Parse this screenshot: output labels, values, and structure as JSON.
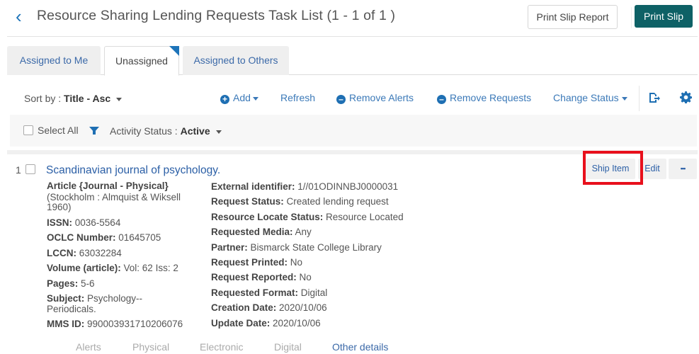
{
  "header": {
    "back_icon": "chevron-left",
    "title": "Resource Sharing Lending Requests Task List (1 - 1 of 1 )",
    "print_slip_report": "Print Slip Report",
    "print_slip": "Print Slip"
  },
  "tabs": [
    {
      "label": "Assigned to Me",
      "active": false
    },
    {
      "label": "Unassigned",
      "active": true
    },
    {
      "label": "Assigned to Others",
      "active": false
    }
  ],
  "toolbar": {
    "sort_label": "Sort by : ",
    "sort_value": "Title - Asc",
    "add": "Add",
    "refresh": "Refresh",
    "remove_alerts": "Remove Alerts",
    "remove_requests": "Remove Requests",
    "change_status": "Change Status",
    "export_icon": "export",
    "settings_icon": "gear"
  },
  "filterbar": {
    "select_all": "Select All",
    "filter_icon": "funnel",
    "activity_label": "Activity Status : ",
    "activity_value": "Active"
  },
  "record": {
    "index": "1",
    "title": "Scandinavian journal of psychology.",
    "type": "Article {Journal - Physical}",
    "publication": "(Stockholm : Almquist & Wiksell 1960)",
    "left_fields": [
      {
        "label": "ISSN:",
        "value": " 0036-5564"
      },
      {
        "label": "OCLC Number:",
        "value": " 01645705"
      },
      {
        "label": "LCCN:",
        "value": " 63032284"
      },
      {
        "label": "Volume (article):",
        "value": " Vol: 62 Iss: 2"
      },
      {
        "label": "Pages:",
        "value": " 5-6"
      },
      {
        "label": "Subject:",
        "value": " Psychology--Periodicals."
      },
      {
        "label": "MMS ID:",
        "value": " 990003931710206076"
      }
    ],
    "right_fields": [
      {
        "label": "External identifier:",
        "value": " 1//01ODINNBJ0000031"
      },
      {
        "label": "Request Status:",
        "value": " Created lending request"
      },
      {
        "label": "Resource Locate Status:",
        "value": " Resource Located"
      },
      {
        "label": "Requested Media:",
        "value": " Any"
      },
      {
        "label": "Partner:",
        "value": " Bismarck State College Library"
      },
      {
        "label": "Request Printed:",
        "value": " No"
      },
      {
        "label": "Request Reported:",
        "value": " No"
      },
      {
        "label": "Requested Format:",
        "value": " Digital"
      },
      {
        "label": "Creation Date:",
        "value": " 2020/10/06"
      },
      {
        "label": "Update Date:",
        "value": " 2020/10/06"
      }
    ],
    "actions": {
      "ship_item": "Ship Item",
      "edit": "Edit",
      "more": "•••"
    },
    "bottom_tabs": [
      {
        "label": "Alerts",
        "active": false
      },
      {
        "label": "Physical",
        "active": false
      },
      {
        "label": "Electronic",
        "active": false
      },
      {
        "label": "Digital",
        "active": false
      },
      {
        "label": "Other details",
        "active": true
      }
    ]
  },
  "colors": {
    "primary_button": "#0e6166",
    "link": "#2b5fa6",
    "accent": "#1e74b9",
    "highlight_box": "#e8101c"
  }
}
